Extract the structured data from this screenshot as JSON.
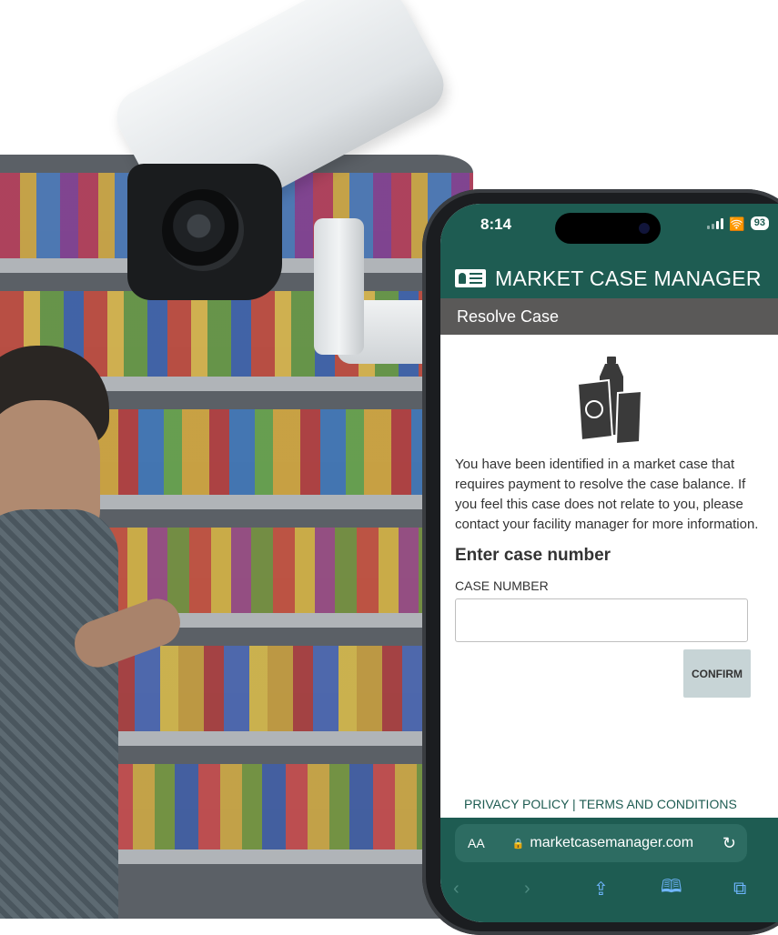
{
  "status_bar": {
    "time": "8:14",
    "battery": "93"
  },
  "app": {
    "title": "MARKET CASE MANAGER",
    "page_heading": "Resolve Case"
  },
  "content": {
    "description": "You have been identified in a market case that requires payment to resolve the case balance. If you feel this case does not relate to you, please contact your facility manager for more information.",
    "section_title": "Enter case number",
    "field_label": "CASE NUMBER",
    "case_number_value": "",
    "confirm_label": "CONFIRM"
  },
  "footer": {
    "links_text": "PRIVACY POLICY | TERMS AND CONDITIONS"
  },
  "browser": {
    "aa_label": "AA",
    "url": "marketcasemanager.com"
  },
  "icons": [
    "security-camera-icon",
    "id-card-icon",
    "snack-bag-icon",
    "lock-icon",
    "reload-icon",
    "back-icon",
    "forward-icon",
    "share-icon",
    "bookmarks-icon",
    "tabs-icon"
  ],
  "colors": {
    "brand": "#1e5c52",
    "subheader": "#5a5958",
    "confirm_bg": "#c7d4d6"
  }
}
